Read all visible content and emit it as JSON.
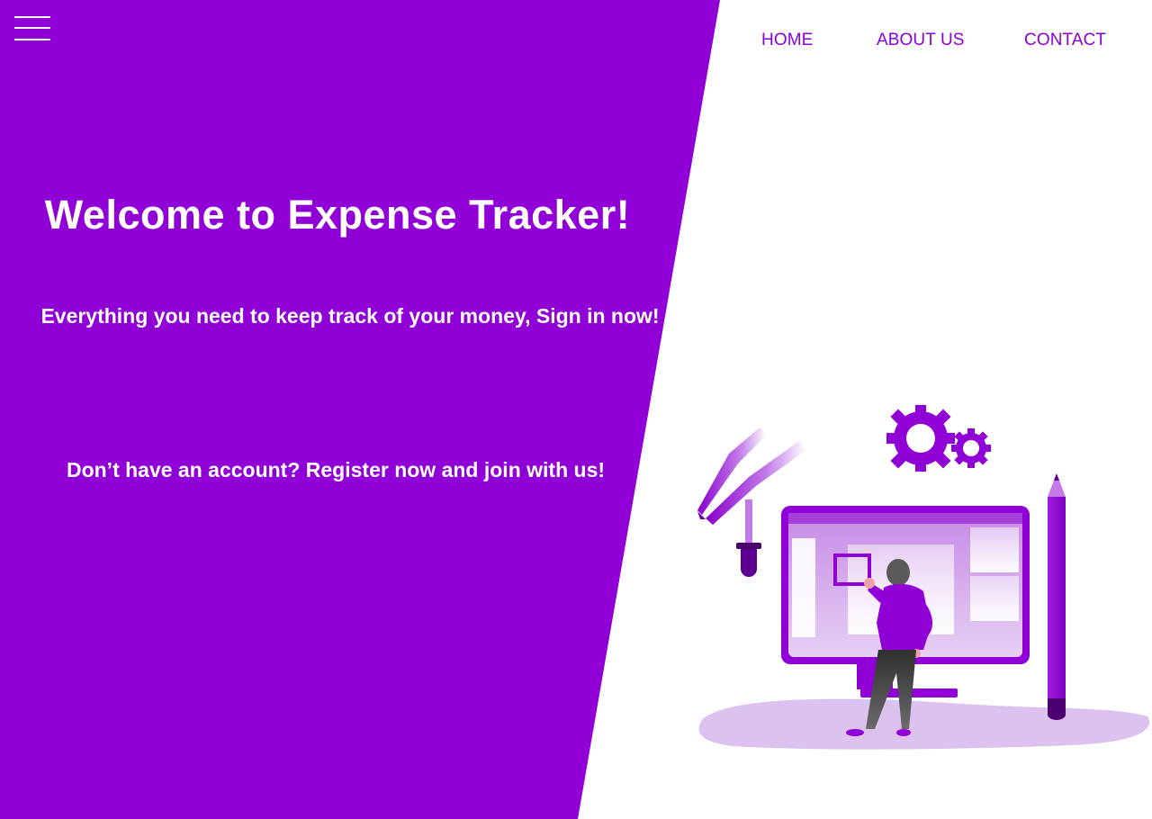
{
  "nav": {
    "home": "HOME",
    "about": "ABOUT US",
    "contact": "CONTACT"
  },
  "hero": {
    "title": "Welcome to Expense Tracker!",
    "subtitle": "Everything you need to keep track of your money, Sign in now!",
    "register_text": "Don’t have an account? Register now and join with us!"
  },
  "icons": {
    "menu": "hamburger-menu-icon",
    "illustration": "designer-at-monitor-illustration"
  },
  "colors": {
    "accent": "#9000d6",
    "nav_text": "#8c00d4",
    "text_on_accent": "#ffffff",
    "illustration_light": "#dcc2ee"
  }
}
